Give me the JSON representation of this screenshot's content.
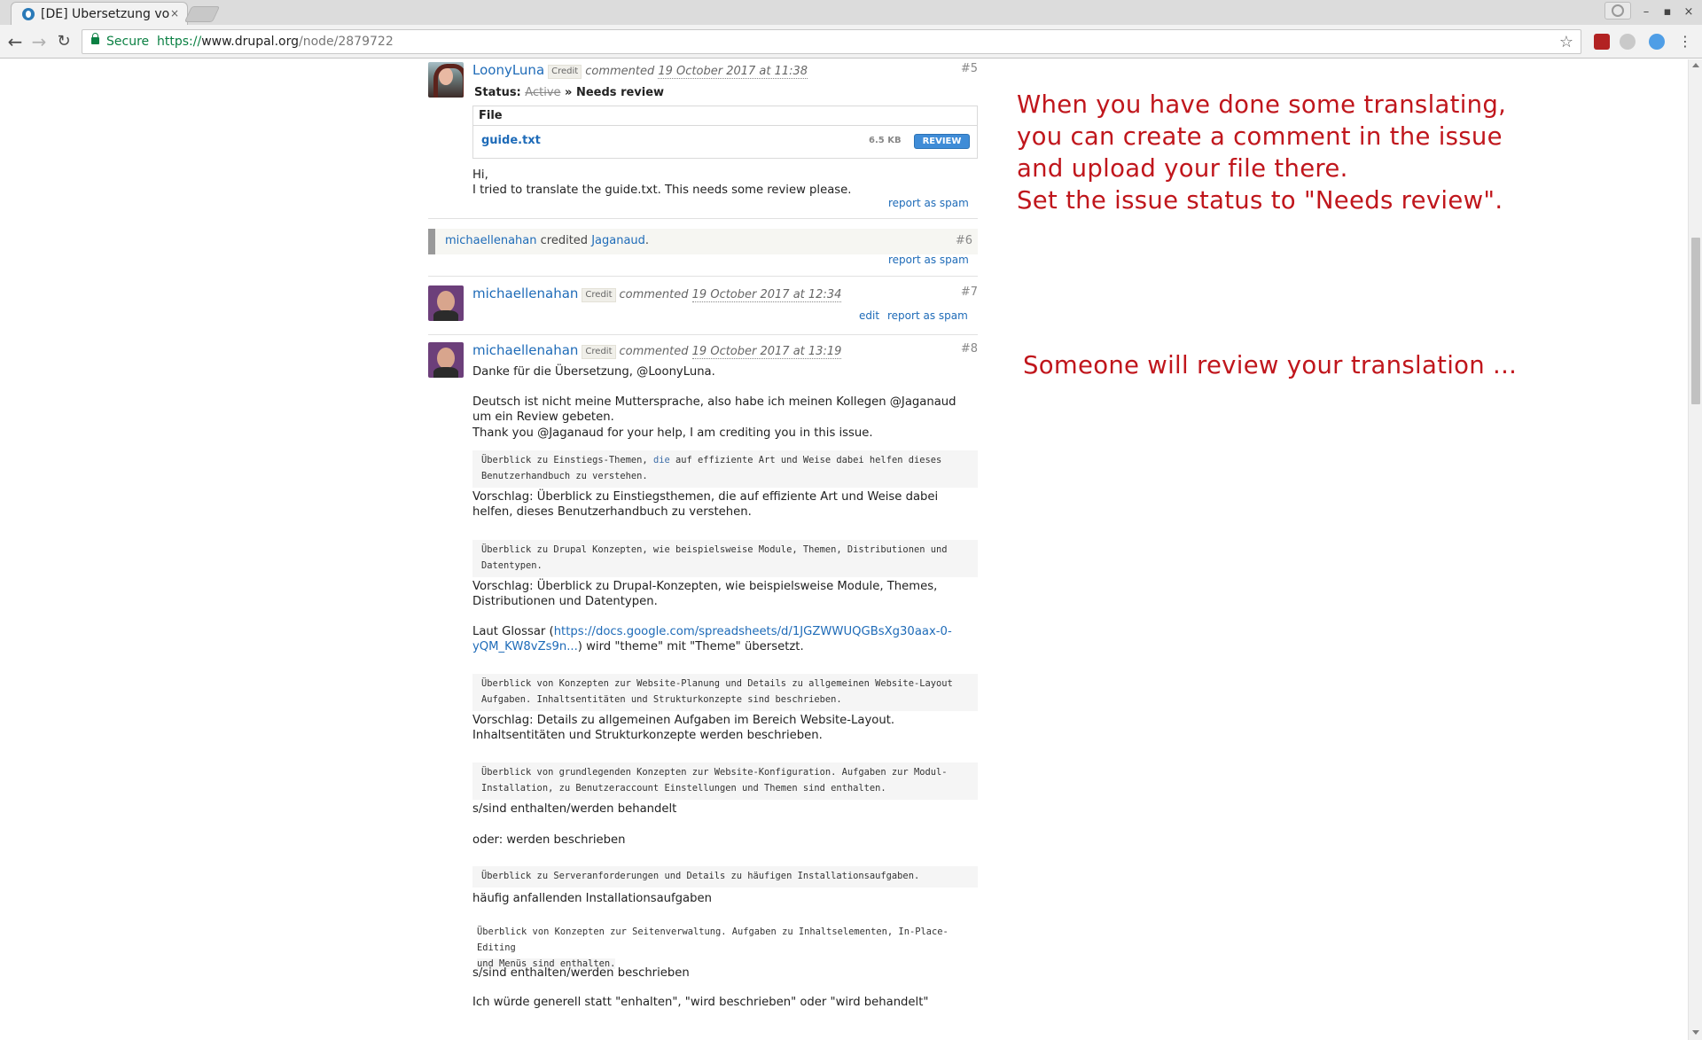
{
  "browser": {
    "tab_title": "[DE] Übersetzung vo",
    "tab_close": "×",
    "secure_label": "Secure",
    "url_scheme": "https://",
    "url_host": "www.drupal.org",
    "url_path": "/node/2879722",
    "window_controls": [
      "–",
      "▪",
      "×"
    ]
  },
  "comments": [
    {
      "author": "LoonyLuna",
      "credit": "Credit",
      "verb": "commented",
      "date": "19 October 2017 at 11:38",
      "number": "#5",
      "status_label": "Status:",
      "status_old": "Active",
      "status_arrow": "»",
      "status_new": "Needs review",
      "file_header": "File",
      "file_name": "guide.txt",
      "file_size": "6.5 KB",
      "file_button": "REVIEW",
      "body": [
        "Hi,",
        "I tried to translate the guide.txt. This needs some review please."
      ],
      "spam": "report as spam"
    },
    {
      "system_user": "michaellenahan",
      "system_text": "credited",
      "system_target": "Jaganaud",
      "system_period": ".",
      "number": "#6",
      "spam": "report as spam"
    },
    {
      "author": "michaellenahan",
      "credit": "Credit",
      "verb": "commented",
      "date": "19 October 2017 at 12:34",
      "number": "#7",
      "edit": "edit",
      "spam": "report as spam"
    },
    {
      "author": "michaellenahan",
      "credit": "Credit",
      "verb": "commented",
      "date": "19 October 2017 at 13:19",
      "number": "#8",
      "p1": "Danke für die Übersetzung, @LoonyLuna.",
      "p2": "Deutsch ist nicht meine Muttersprache, also habe ich meinen Kollegen @Jaganaud um ein Review gebeten.",
      "p3": "Thank you @Jaganaud for your help, I am crediting you in this issue.",
      "code1a": "Überblick zu Einstiegs-Themen, ",
      "code1hl": "die",
      "code1b": " auf effiziente Art und Weise dabei helfen dieses",
      "code1c": "Benutzerhandbuch zu verstehen.",
      "s1": "Vorschlag: Überblick zu Einstiegsthemen, die auf effiziente Art und Weise dabei helfen, dieses Benutzerhandbuch zu verstehen.",
      "code2a": "Überblick zu Drupal Konzepten, wie beispielsweise Module, Themen, Distributionen und",
      "code2b": "Datentypen.",
      "s2": "Vorschlag: Überblick zu Drupal-Konzepten, wie beispielsweise Module, Themes, Distributionen und Datentypen.",
      "gloss_a": "Laut Glossar (",
      "gloss_link": "https://docs.google.com/spreadsheets/d/1JGZWWUQGBsXg30aax-0-yQM_KW8vZs9n...",
      "gloss_b": ") wird \"theme\" mit \"Theme\" übersetzt.",
      "code3a": "Überblick von Konzepten zur Website-Planung und Details zu allgemeinen Website-Layout",
      "code3b": "Aufgaben. Inhaltsentitäten und Strukturkonzepte sind beschrieben.",
      "s3": "Vorschlag: Details zu allgemeinen Aufgaben im Bereich Website-Layout. Inhaltsentitäten und Strukturkonzepte werden beschrieben.",
      "code4a": "Überblick von grundlegenden Konzepten zur Website-Konfiguration. Aufgaben zur Modul-",
      "code4b": "Installation, zu Benutzeraccount Einstellungen und Themen sind enthalten.",
      "s4": "s/sind enthalten/werden behandelt",
      "s5": "oder: werden beschrieben",
      "code5": "Überblick zu Serveranforderungen und Details zu häufigen Installationsaufgaben.",
      "s6": "häufig anfallenden Installationsaufgaben",
      "code6a": "Überblick von Konzepten zur Seitenverwaltung. Aufgaben zu Inhaltselementen, In-Place-Editing",
      "code6b": "und Menüs sind enthalten.",
      "s7": "s/sind enthalten/werden beschrieben",
      "s8": "Ich würde generell statt \"enhalten\", \"wird beschrieben\" oder \"wird behandelt\""
    }
  ],
  "annotations": {
    "first": [
      "When you have done some translating,",
      "you can create a comment in the issue",
      "and upload your file there.",
      "Set the issue status to \"Needs review\"."
    ],
    "second": "Someone will review your translation ..."
  },
  "colors": {
    "annotation": "#c0161c",
    "link": "#1e6bb8",
    "secure": "#0b8043",
    "review_button": "#3f8cd7"
  }
}
